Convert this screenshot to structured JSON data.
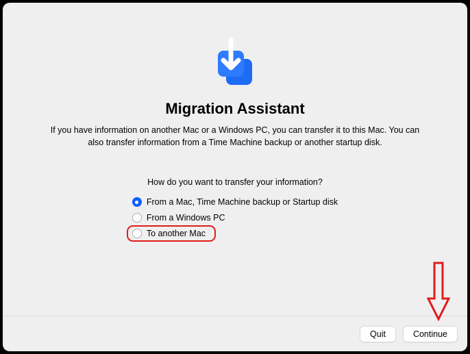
{
  "header": {
    "title": "Migration Assistant",
    "description": "If you have information on another Mac or a Windows PC, you can transfer it to this Mac. You can also transfer information from a Time Machine backup or another startup disk."
  },
  "form": {
    "prompt": "How do you want to transfer your information?",
    "options": [
      {
        "label": "From a Mac, Time Machine backup or Startup disk",
        "selected": true
      },
      {
        "label": "From a Windows PC",
        "selected": false
      },
      {
        "label": "To another Mac",
        "selected": false,
        "highlighted": true
      }
    ]
  },
  "footer": {
    "quit_label": "Quit",
    "continue_label": "Continue"
  },
  "colors": {
    "accent": "#0a60ff",
    "annotation": "#e11b1b"
  },
  "icon": {
    "name": "migration-download-icon"
  }
}
